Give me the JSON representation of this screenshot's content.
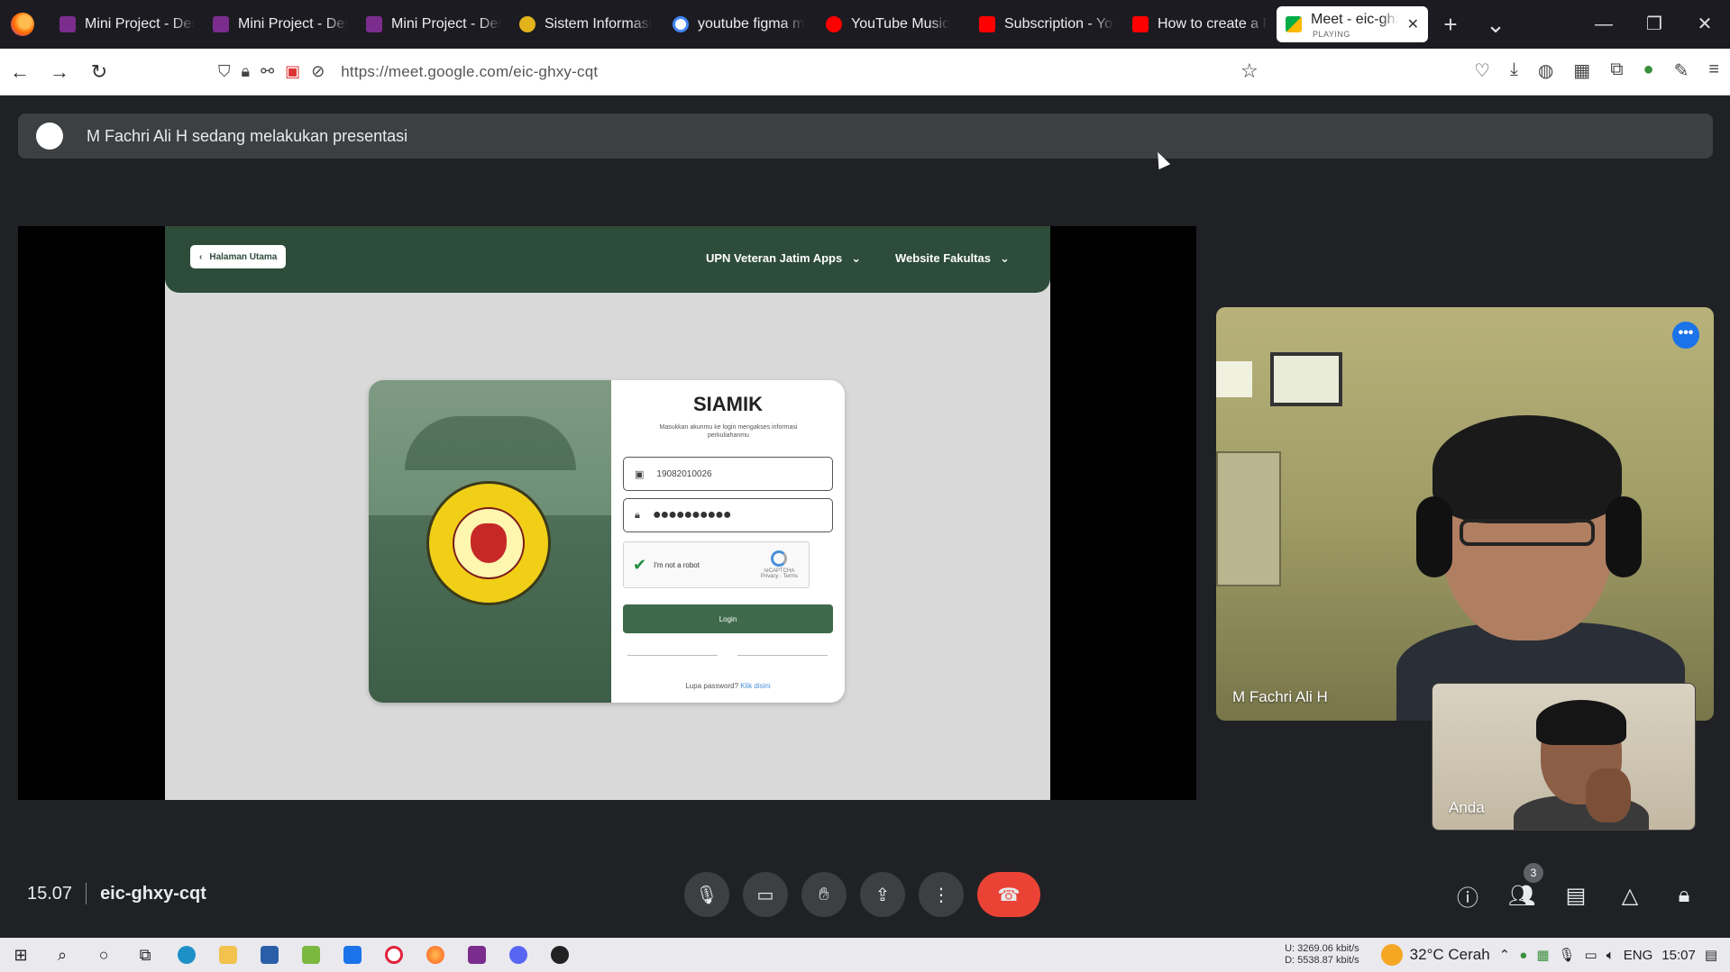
{
  "browser": {
    "tabs": [
      {
        "title": "Mini Project - Des",
        "favicon_color": "#7b2d8e"
      },
      {
        "title": "Mini Project - Des",
        "favicon_color": "#7b2d8e"
      },
      {
        "title": "Mini Project - Des",
        "favicon_color": "#7b2d8e"
      },
      {
        "title": "Sistem Informasi",
        "favicon_color": "#e3b31b"
      },
      {
        "title": "youtube figma m",
        "favicon_color": "#4285f4"
      },
      {
        "title": "YouTube Music",
        "favicon_color": "#ff0000"
      },
      {
        "title": "Subscription - You",
        "favicon_color": "#ff0000"
      },
      {
        "title": "How to create a F",
        "favicon_color": "#ff0000"
      }
    ],
    "active_tab": {
      "title": "Meet - eic-ghx",
      "subtitle": "PLAYING"
    },
    "new_tab": "+",
    "tab_list": "⌄",
    "win": {
      "min": "—",
      "max": "❐",
      "close": "✕"
    },
    "url": "https://meet.google.com/eic-ghxy-cqt"
  },
  "meet": {
    "presenting_banner": "M Fachri Ali H sedang melakukan presentasi",
    "shared_screen": {
      "back_button": "Halaman Utama",
      "nav_items": [
        "UPN Veteran Jatim Apps",
        "Website Fakultas"
      ],
      "card": {
        "title": "SIAMIK",
        "subtitle": "Masukkan akunmu ke login mengakses informasi perkuliahanmu",
        "username": "19082010026",
        "password_mask": "●●●●●●●●●●",
        "captcha_label": "I'm not a robot",
        "captcha_brand": "reCAPTCHA",
        "captcha_terms": "Privacy - Terms",
        "login_label": "Login",
        "forgot_text": "Lupa password?",
        "forgot_link": "Klik disini"
      }
    },
    "participants": [
      {
        "name": "M Fachri Ali H"
      },
      {
        "name": "Anda"
      }
    ],
    "time": "15.07",
    "meeting_code": "eic-ghxy-cqt",
    "participant_count": "3",
    "more_glyph": "•••"
  },
  "taskbar": {
    "net_up": "U:   3269.06 kbit/s",
    "net_down": "D:   5538.87 kbit/s",
    "weather": "32°C  Cerah",
    "lang": "ENG",
    "clock": "15:07"
  },
  "colors": {
    "meet_bg": "#202124",
    "end_call": "#ea4335",
    "siamik_header": "#2e4c3a",
    "login_button": "#3e6a4b"
  }
}
